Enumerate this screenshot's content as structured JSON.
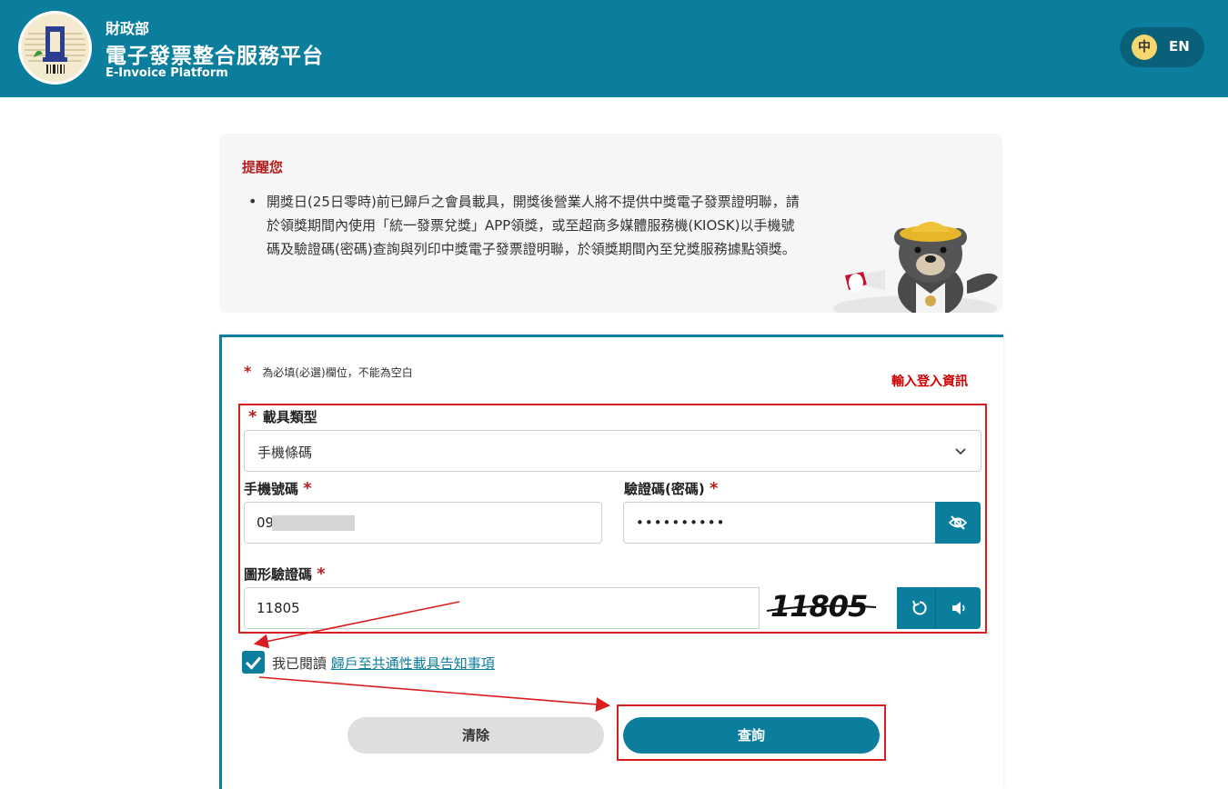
{
  "header": {
    "ministry": "財政部",
    "title": "電子發票整合服務平台",
    "title_en": "E-Invoice Platform",
    "lang_zh": "中",
    "lang_en": "EN"
  },
  "notice": {
    "title": "提醒您",
    "body": "開獎日(25日零時)前已歸戶之會員載具，開獎後營業人將不提供中獎電子發票證明聯，請於領獎期間內使用「統一發票兌獎」APP領獎，或至超商多媒體服務機(KIOSK)以手機號碼及驗證碼(密碼)查詢與列印中獎電子發票證明聯，於領獎期間內至兌獎服務據點領獎。"
  },
  "form": {
    "required_note": "為必填(必選)欄位，不能為空白",
    "annotation": "輸入登入資訊",
    "carrier_type_label": "載具類型",
    "carrier_type_value": "手機條碼",
    "phone_label": "手機號碼",
    "phone_value": "09",
    "password_label": "驗證碼(密碼)",
    "password_value": "••••••••••",
    "captcha_label": "圖形驗證碼",
    "captcha_value": "11805",
    "captcha_image_text": "11805",
    "agree_prefix": "我已閱讀",
    "agree_link": "歸戶至共通性載具告知事項",
    "clear_button": "清除",
    "query_button": "查詢"
  },
  "colors": {
    "brand": "#0c7e9d",
    "alert_red": "#b41e1e",
    "annotation_red": "#d81e1e"
  },
  "icons": {
    "password_toggle": "eye-off-icon",
    "captcha_refresh": "refresh-icon",
    "captcha_audio": "speaker-icon",
    "select_chevron": "chevron-down-icon"
  }
}
